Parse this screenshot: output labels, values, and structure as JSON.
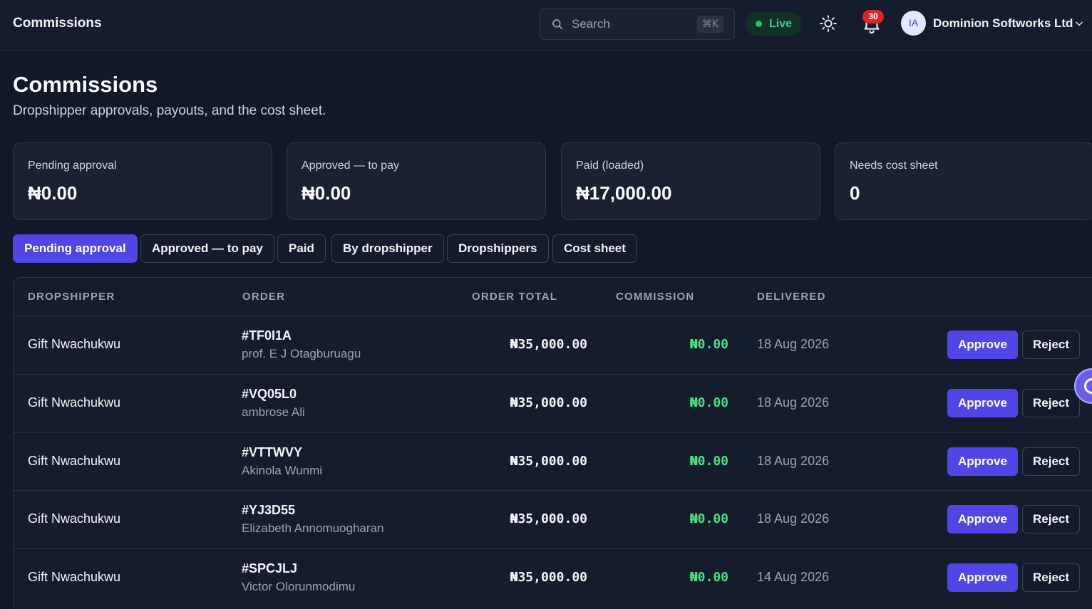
{
  "header": {
    "app_title": "Commissions",
    "search_placeholder": "Search",
    "search_shortcut": "⌘K",
    "live_label": "Live",
    "notification_count": "30",
    "avatar_initials": "IA",
    "org_name": "Dominion Softworks Ltd"
  },
  "page": {
    "title": "Commissions",
    "subtitle": "Dropshipper approvals, payouts, and the cost sheet."
  },
  "stats": [
    {
      "label": "Pending approval",
      "value": "₦0.00"
    },
    {
      "label": "Approved — to pay",
      "value": "₦0.00"
    },
    {
      "label": "Paid (loaded)",
      "value": "₦17,000.00"
    },
    {
      "label": "Needs cost sheet",
      "value": "0"
    }
  ],
  "tabs": [
    {
      "label": "Pending approval",
      "active": true
    },
    {
      "label": "Approved — to pay",
      "active": false
    },
    {
      "label": "Paid",
      "active": false
    },
    {
      "label": "By dropshipper",
      "active": false
    },
    {
      "label": "Dropshippers",
      "active": false
    },
    {
      "label": "Cost sheet",
      "active": false
    }
  ],
  "table": {
    "columns": {
      "dropshipper": "Dropshipper",
      "order": "Order",
      "order_total": "Order total",
      "commission": "Commission",
      "delivered": "Delivered"
    },
    "approve_label": "Approve",
    "reject_label": "Reject",
    "rows": [
      {
        "dropshipper": "Gift Nwachukwu",
        "order_id": "#TF0I1A",
        "customer": "prof. E J Otagburuagu",
        "total": "₦35,000.00",
        "commission": "₦0.00",
        "delivered": "18 Aug 2026"
      },
      {
        "dropshipper": "Gift Nwachukwu",
        "order_id": "#VQ05L0",
        "customer": "ambrose Ali",
        "total": "₦35,000.00",
        "commission": "₦0.00",
        "delivered": "18 Aug 2026"
      },
      {
        "dropshipper": "Gift Nwachukwu",
        "order_id": "#VTTWVY",
        "customer": "Akinola Wunmi",
        "total": "₦35,000.00",
        "commission": "₦0.00",
        "delivered": "18 Aug 2026"
      },
      {
        "dropshipper": "Gift Nwachukwu",
        "order_id": "#YJ3D55",
        "customer": "Elizabeth Annomuogharan",
        "total": "₦35,000.00",
        "commission": "₦0.00",
        "delivered": "18 Aug 2026"
      },
      {
        "dropshipper": "Gift Nwachukwu",
        "order_id": "#SPCJLJ",
        "customer": "Victor Olorunmodimu",
        "total": "₦35,000.00",
        "commission": "₦0.00",
        "delivered": "14 Aug 2026"
      }
    ]
  }
}
